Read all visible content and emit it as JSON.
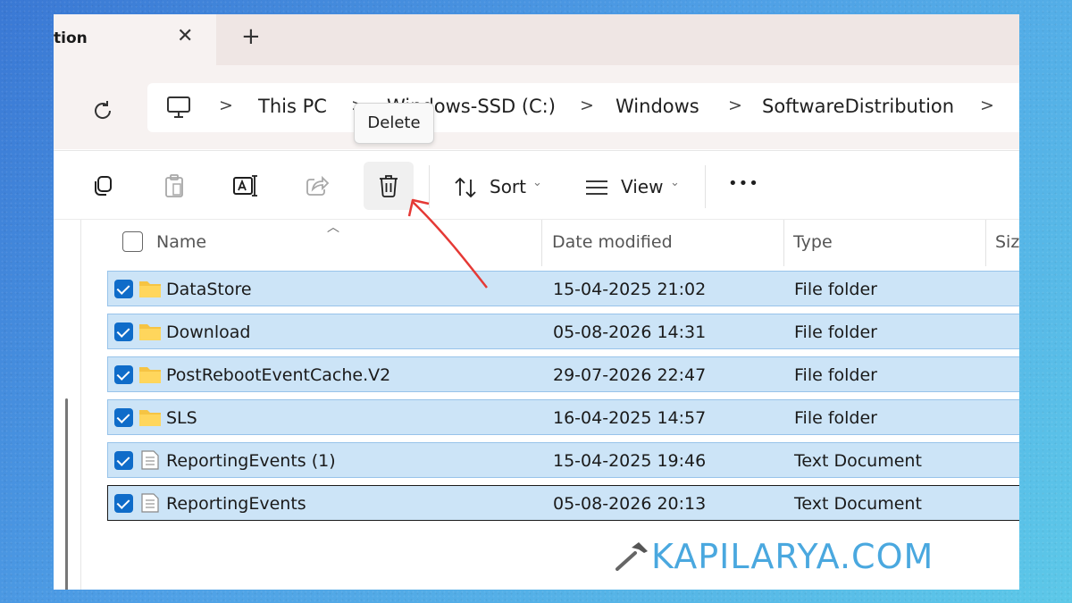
{
  "tab": {
    "title": "tion",
    "close": "✕",
    "new": "+"
  },
  "breadcrumb": {
    "items": [
      "This PC",
      "Windows-SSD (C:)",
      "Windows",
      "SoftwareDistribution"
    ],
    "separator": ">"
  },
  "toolbar": {
    "sort_label": "Sort",
    "view_label": "View",
    "more_label": "•••",
    "caret": "⌄",
    "tooltip": "Delete"
  },
  "columns": {
    "name": "Name",
    "date": "Date modified",
    "type": "Type",
    "size": "Size"
  },
  "rows": [
    {
      "name": "DataStore",
      "date": "15-04-2025 21:02",
      "type": "File folder",
      "icon": "folder-icon"
    },
    {
      "name": "Download",
      "date": "05-08-2026 14:31",
      "type": "File folder",
      "icon": "folder-icon"
    },
    {
      "name": "PostRebootEventCache.V2",
      "date": "29-07-2026 22:47",
      "type": "File folder",
      "icon": "folder-icon"
    },
    {
      "name": "SLS",
      "date": "16-04-2025 14:57",
      "type": "File folder",
      "icon": "folder-icon"
    },
    {
      "name": "ReportingEvents (1)",
      "date": "15-04-2025 19:46",
      "type": "Text Document",
      "icon": "text-document-icon"
    },
    {
      "name": "ReportingEvents",
      "date": "05-08-2026 20:13",
      "type": "Text Document",
      "icon": "text-document-icon"
    }
  ],
  "watermark": {
    "text": "KAPILARYA.COM"
  },
  "colors": {
    "selection": "#cce4f7",
    "checkbox": "#0f6cc9",
    "arrow": "#e53935",
    "watermark": "#4aa8df"
  }
}
